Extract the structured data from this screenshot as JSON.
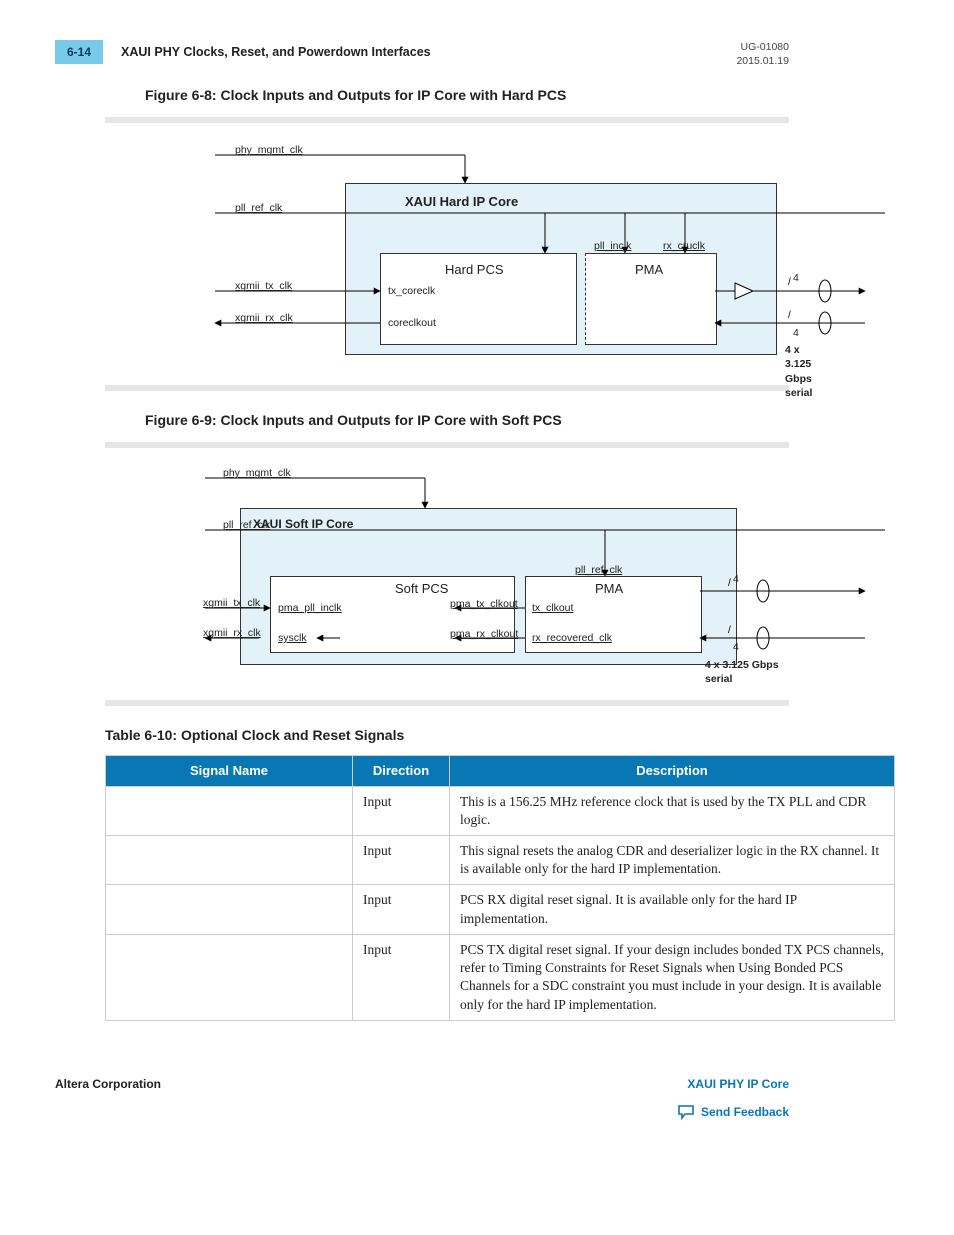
{
  "header": {
    "page_num": "6-14",
    "section": "XAUI PHY Clocks, Reset, and Powerdown Interfaces",
    "doc_ref": "UG-01080",
    "doc_date": "2015.01.19"
  },
  "figures": {
    "f68": {
      "title": "Figure 6-8: Clock Inputs and Outputs for IP Core with Hard PCS",
      "labels": {
        "phy_mgmt_clk": "phy_mgmt_clk",
        "pll_ref_clk": "pll_ref_clk",
        "xgmii_tx_clk": "xgmii_tx_clk",
        "xgmii_rx_clk": "xgmii_rx_clk",
        "core": "XAUI Hard IP Core",
        "hard_pcs": "Hard PCS",
        "pma": "PMA",
        "tx_coreclk": "tx_coreclk",
        "coreclkout": "coreclkout",
        "pll_inclk": "pll_inclk",
        "rx_cruclk": "rx_cruclk",
        "four_a": "4",
        "four_b": "4",
        "serial": "4 x 3.125 Gbps serial"
      }
    },
    "f69": {
      "title": "Figure 6-9: Clock Inputs and Outputs for IP Core with Soft PCS",
      "labels": {
        "phy_mgmt_clk": "phy_mgmt_clk",
        "pll_ref_clk": "pll_ref_clk",
        "xgmii_tx_clk": "xgmii_tx_clk",
        "xgmii_rx_clk": "xgmii_rx_clk",
        "core": "XAUI Soft IP Core",
        "soft_pcs": "Soft PCS",
        "pma": "PMA",
        "pma_pll_inclk": "pma_pll_inclk",
        "sysclk": "sysclk",
        "pma_tx_clkout": "pma_tx_clkout",
        "pma_rx_clkout": "pma_rx_clkout",
        "pll_ref_clk2": "pll_ref_clk",
        "tx_clkout": "tx_clkout",
        "rx_recovered_clk": "rx_recovered_clk",
        "four_a": "4",
        "four_b": "4",
        "serial": "4 x 3.125 Gbps serial"
      }
    }
  },
  "table": {
    "title": "Table 6-10: Optional Clock and Reset Signals",
    "headers": {
      "name": "Signal Name",
      "dir": "Direction",
      "desc": "Description"
    },
    "rows": [
      {
        "name": "",
        "dir": "Input",
        "desc": "This is a 156.25 MHz reference clock that is used by the TX PLL and CDR logic."
      },
      {
        "name": "",
        "dir": "Input",
        "desc": "This signal resets the analog CDR and deserializer logic in the RX channel. It is available only for the hard IP implementation."
      },
      {
        "name": "",
        "dir": "Input",
        "desc": "PCS RX digital reset signal. It is available only for the hard IP implementation."
      },
      {
        "name": "",
        "dir": "Input",
        "desc": "PCS TX digital reset signal. If your design includes bonded TX PCS channels, refer to Timing Constraints for Reset Signals when Using Bonded PCS Channels for a SDC constraint you must include in your design. It is available only for the hard IP implementation."
      }
    ]
  },
  "footer": {
    "left": "Altera Corporation",
    "right_link": "XAUI PHY IP Core",
    "feedback": "Send Feedback"
  }
}
